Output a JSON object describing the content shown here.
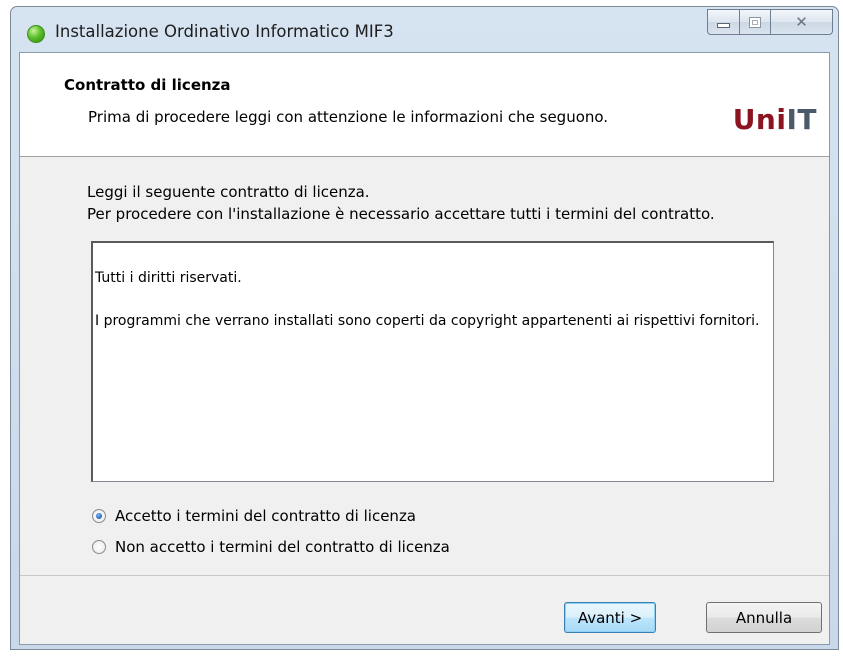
{
  "window": {
    "title": "Installazione Ordinativo Informatico MIF3",
    "close_glyph": "✕"
  },
  "header": {
    "title": "Contratto di licenza",
    "subtitle": "Prima di procedere leggi con attenzione le informazioni che seguono.",
    "logo_part1": "Uni",
    "logo_part2": "IT"
  },
  "body": {
    "intro_line1": "Leggi il seguente contratto di licenza.",
    "intro_line2": "Per procedere con l'installazione è necessario accettare tutti i termini del contratto.",
    "license_paragraphs": [
      "Tutti i diritti riservati.",
      "I programmi che verrano installati sono coperti da copyright appartenenti ai rispettivi fornitori."
    ]
  },
  "options": {
    "accept_label": "Accetto i termini del contratto di licenza",
    "decline_label": "Non accetto i termini del contratto di licenza",
    "selected": "accept"
  },
  "buttons": {
    "next_label": "Avanti >",
    "cancel_label": "Annulla"
  }
}
